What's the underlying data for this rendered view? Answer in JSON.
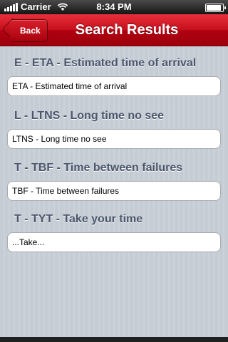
{
  "status_bar": {
    "carrier": "Carrier",
    "time": "8:34 PM",
    "battery_level": 1.0
  },
  "nav": {
    "back_label": "Back",
    "title": "Search Results"
  },
  "results": [
    {
      "header": "E - ETA - Estimated time of arrival",
      "cell": "ETA - Estimated time of arrival"
    },
    {
      "header": "L - LTNS - Long time no see",
      "cell": "LTNS - Long time no see"
    },
    {
      "header": "T - TBF - Time between failures",
      "cell": "TBF - Time between failures"
    },
    {
      "header": "T - TYT - Take your time",
      "cell": "...Take..."
    }
  ],
  "colors": {
    "nav_red": "#c60f1c",
    "section_header": "#4c566c",
    "background": "#c5ccd4"
  }
}
